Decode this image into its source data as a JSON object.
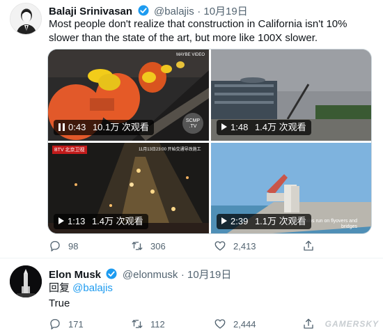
{
  "tweet1": {
    "name": "Balaji Srinivasan",
    "handle": "@balajis",
    "date": "· 10月19日",
    "text": "Most people don't realize that construction in California isn't 10% slower than the state of the art, but more like 100X slower.",
    "videos": [
      {
        "time": "0:43",
        "views": "10.1万 次观看",
        "state": "paused",
        "overlay_br": "SCMP .TV",
        "overlay_tl": "",
        "overlay_tr": "MAYBE VIDEO"
      },
      {
        "time": "1:48",
        "views": "1.4万 次观看",
        "state": "play",
        "overlay_br": "",
        "overlay_tl": "",
        "overlay_tr": ""
      },
      {
        "time": "1:13",
        "views": "1.4万 次观看",
        "state": "play",
        "overlay_br": "",
        "overlay_tl": "BTV 北京卫视",
        "overlay_tr": "11月13日23:00 开始交通导改施工"
      },
      {
        "time": "2:39",
        "views": "1.1万 次观看",
        "state": "play",
        "overlay_br": "d railway trains run on flyovers and bridges",
        "overlay_tl": "",
        "overlay_tr": ""
      }
    ],
    "replies": "98",
    "retweets": "306",
    "likes": "2,413"
  },
  "tweet2": {
    "name": "Elon Musk",
    "handle": "@elonmusk",
    "date": "· 10月19日",
    "reply_prefix": "回复 ",
    "reply_to": "@balajis",
    "text": "True",
    "replies": "171",
    "retweets": "112",
    "likes": "2,444"
  },
  "watermark": "GAMERSKY",
  "colors": {
    "accent": "#1d9bf0",
    "muted": "#536471",
    "text": "#0f1419"
  }
}
